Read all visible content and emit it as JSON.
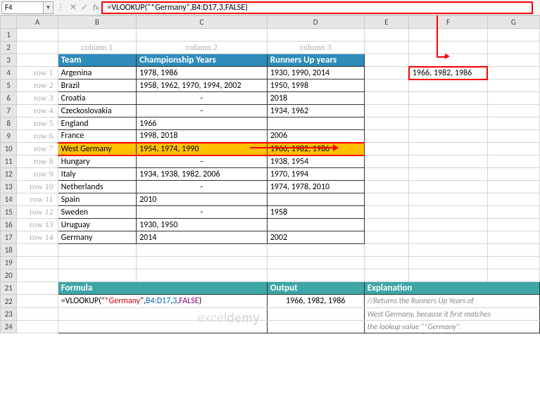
{
  "nameBox": "F4",
  "formulaBar": "=VLOOKUP(\"*Germany\",B4:D17,3,FALSE)",
  "colLabels": {
    "c1": "column 1",
    "c2": "column 2",
    "c3": "column 3"
  },
  "rowLabels": [
    "row 1",
    "row 2",
    "row 3",
    "row 4",
    "row 5",
    "row 6",
    "row 7",
    "row 8",
    "row 9",
    "row 10",
    "row 11",
    "row 12",
    "row 13",
    "row 14"
  ],
  "headers": {
    "team": "Team",
    "champ": "Championship Years",
    "runners": "Runners Up years"
  },
  "rows": [
    {
      "team": "Argenina",
      "champ": "1978, 1986",
      "runners": "1930, 1990, 2014"
    },
    {
      "team": "Brazil",
      "champ": "1958, 1962, 1970, 1994, 2002",
      "runners": "1950, 1998"
    },
    {
      "team": "Croatia",
      "champ": "-",
      "runners": "2018"
    },
    {
      "team": "Czeckoslovakia",
      "champ": "-",
      "runners": "1934, 1962"
    },
    {
      "team": "England",
      "champ": "1966",
      "runners": ""
    },
    {
      "team": "France",
      "champ": "1998, 2018",
      "runners": "2006"
    },
    {
      "team": "West Germany",
      "champ": "1954, 1974, 1990",
      "runners": "1966, 1982, 1986"
    },
    {
      "team": "Hungary",
      "champ": "-",
      "runners": "1938, 1954"
    },
    {
      "team": "Italy",
      "champ": "1934, 1938, 1982, 2006",
      "runners": "1970, 1994"
    },
    {
      "team": "Netherlands",
      "champ": "-",
      "runners": "1974, 1978, 2010"
    },
    {
      "team": "Spain",
      "champ": "2010",
      "runners": ""
    },
    {
      "team": "Sweden",
      "champ": "-",
      "runners": "1958"
    },
    {
      "team": "Uruguay",
      "champ": "1930, 1950",
      "runners": ""
    },
    {
      "team": "Germany",
      "champ": "2014",
      "runners": "2002"
    }
  ],
  "resultCell": "1966, 1982, 1986",
  "explain": {
    "hFormula": "Formula",
    "hOutput": "Output",
    "hExpl": "Explanation",
    "f_pre": "=VLOOKUP(",
    "f_q": "\"",
    "f_star": "*",
    "f_germ": "Germany",
    "f_q2": "\"",
    "f_c1": ",",
    "f_range": "B4:D17",
    "f_c2": ",",
    "f_three": "3",
    "f_c3": ",",
    "f_false": "FALSE",
    "f_close": ")",
    "output": "1966, 1982, 1986",
    "e1": "//Returns the Runners Up Years of",
    "e2": "West Germany, because it first matches",
    "e3": "the lookup value \"*Germany\"."
  },
  "watermark": {
    "p1": "excel",
    "p2": "demy"
  },
  "colHeads": [
    "",
    "A",
    "B",
    "C",
    "D",
    "E",
    "F",
    "G"
  ],
  "chart_data": {
    "type": "table",
    "title": "VLOOKUP wildcard example",
    "columns": [
      "Team",
      "Championship Years",
      "Runners Up years"
    ],
    "data": [
      [
        "Argenina",
        "1978, 1986",
        "1930, 1990, 2014"
      ],
      [
        "Brazil",
        "1958, 1962, 1970, 1994, 2002",
        "1950, 1998"
      ],
      [
        "Croatia",
        "-",
        "2018"
      ],
      [
        "Czeckoslovakia",
        "-",
        "1934, 1962"
      ],
      [
        "England",
        "1966",
        ""
      ],
      [
        "France",
        "1998, 2018",
        "2006"
      ],
      [
        "West Germany",
        "1954, 1974, 1990",
        "1966, 1982, 1986"
      ],
      [
        "Hungary",
        "-",
        "1938, 1954"
      ],
      [
        "Italy",
        "1934, 1938, 1982, 2006",
        "1970, 1994"
      ],
      [
        "Netherlands",
        "-",
        "1974, 1978, 2010"
      ],
      [
        "Spain",
        "2010",
        ""
      ],
      [
        "Sweden",
        "-",
        "1958"
      ],
      [
        "Uruguay",
        "1930, 1950",
        ""
      ],
      [
        "Germany",
        "2014",
        "2002"
      ]
    ]
  }
}
